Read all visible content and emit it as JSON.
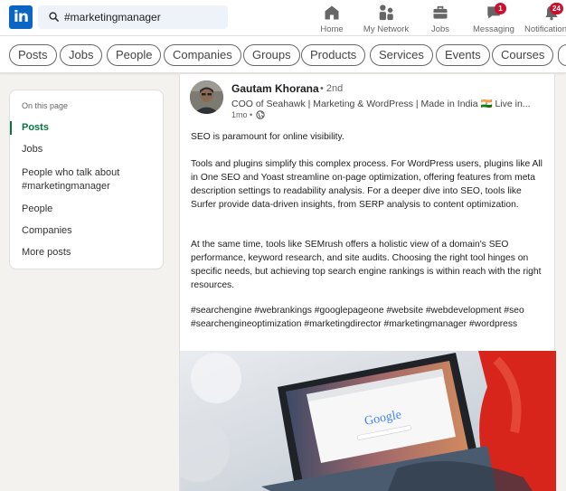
{
  "nav": {
    "logo": "in",
    "search_value": "#marketingmanager",
    "items": [
      {
        "label": "Home",
        "icon": "home-icon"
      },
      {
        "label": "My Network",
        "icon": "network-icon"
      },
      {
        "label": "Jobs",
        "icon": "briefcase-icon"
      },
      {
        "label": "Messaging",
        "icon": "messaging-icon",
        "badge": "1"
      },
      {
        "label": "Notifications",
        "icon": "bell-icon",
        "badge": "24"
      }
    ]
  },
  "filters": [
    "Posts",
    "Jobs",
    "People",
    "Companies",
    "Groups",
    "Products",
    "Services",
    "Events",
    "Courses"
  ],
  "sidebar": {
    "caption": "On this page",
    "items": [
      {
        "label": "Posts",
        "active": true
      },
      {
        "label": "Jobs"
      },
      {
        "label": "People who talk about #marketingmanager"
      },
      {
        "label": "People"
      },
      {
        "label": "Companies"
      },
      {
        "label": "More posts"
      }
    ]
  },
  "post": {
    "author": "Gautam Khorana",
    "degree": "• 2nd",
    "headline": "COO of Seahawk | Marketing & WordPress | Made in India 🇮🇳 Live in...",
    "time": "1mo •",
    "paragraphs": [
      "SEO is paramount for online visibility.",
      "Tools and plugins simplify this complex process. For WordPress users, plugins like All in One SEO and Yoast streamline on-page optimization, offering features from meta description settings to readability analysis. For a deeper dive into SEO, tools like Surfer provide data-driven insights, from SERP analysis to content optimization.",
      "At the same time, tools like SEMrush offers a holistic view of a domain's SEO performance, keyword research, and site audits. Choosing the right tool hinges on specific needs, but achieving top search engine rankings is within reach with the right resources."
    ],
    "hashtags": "#searchengine #webrankings #googlepageone #website #webdevelopment #seo #searchengineoptimization #marketingdirector #marketingmanager #wordpress",
    "image_text": "Google"
  },
  "colors": {
    "brand": "#0a66c2",
    "active": "#057642",
    "badge": "#cb112d"
  }
}
